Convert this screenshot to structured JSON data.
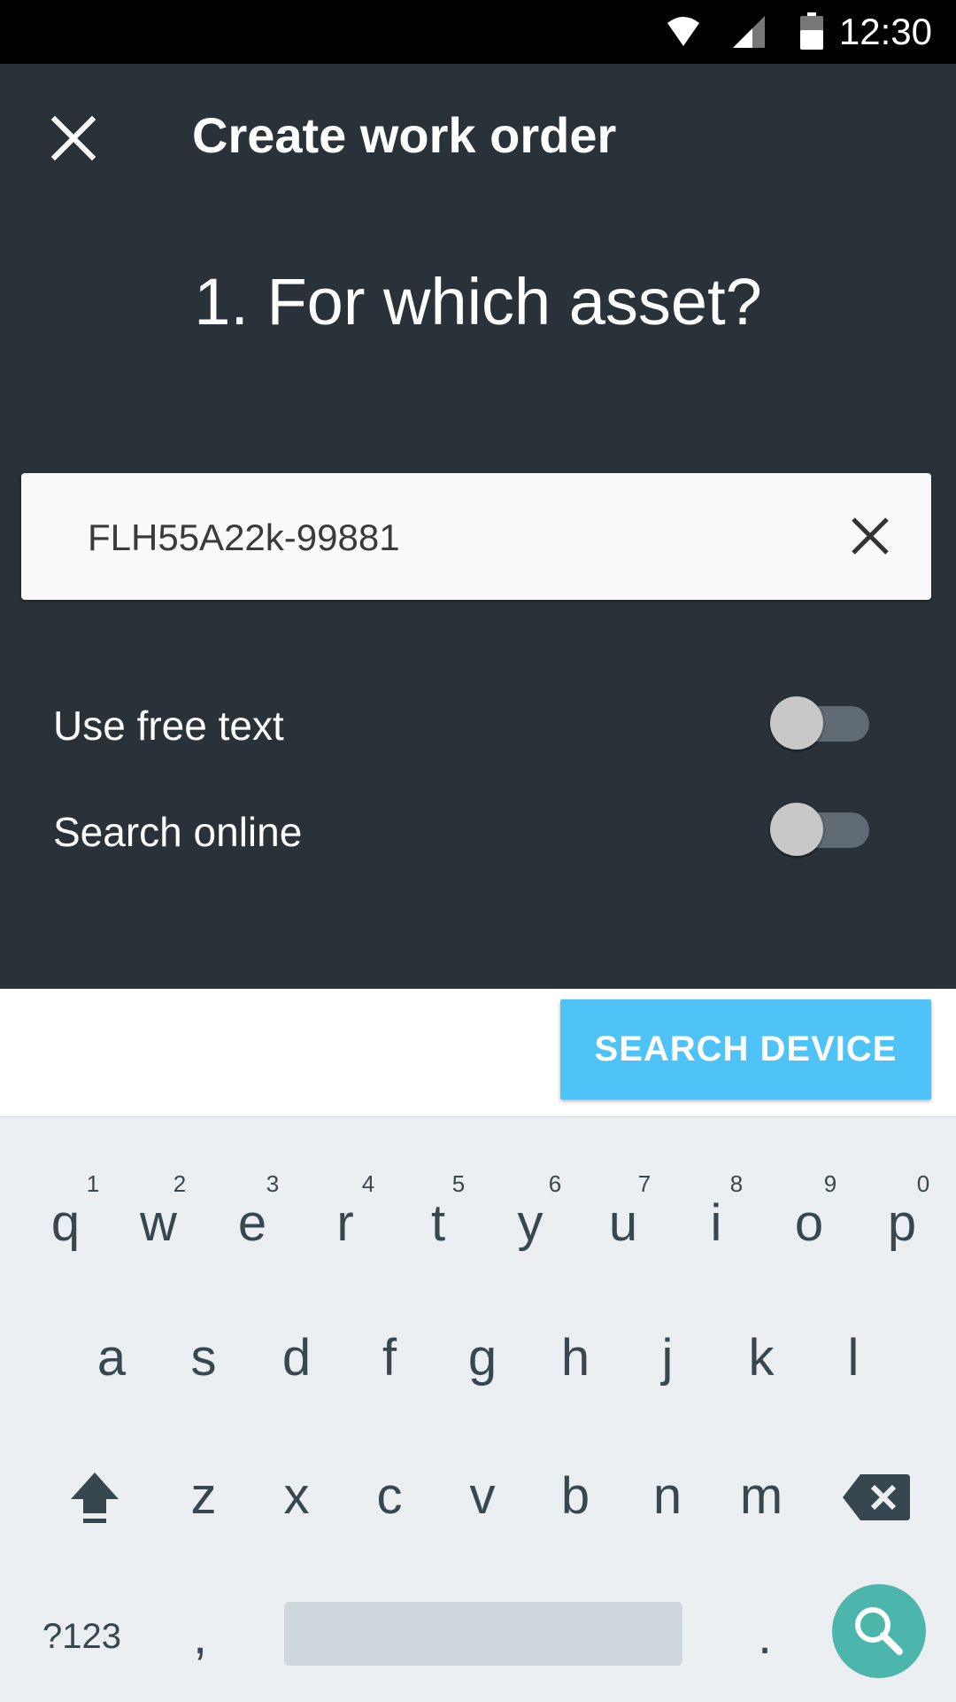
{
  "status_bar": {
    "time": "12:30",
    "icons": [
      "wifi-icon",
      "cell-signal-icon",
      "battery-icon"
    ]
  },
  "header": {
    "close_icon": "close-icon",
    "title": "Create work order"
  },
  "step": {
    "title": "1. For which asset?"
  },
  "asset_input": {
    "value": "FLH55A22k-99881",
    "clear_icon": "clear-icon"
  },
  "options": [
    {
      "label": "Use free text",
      "enabled": false
    },
    {
      "label": "Search online",
      "enabled": false
    }
  ],
  "actions": {
    "search_device_label": "SEARCH DEVICE"
  },
  "keyboard": {
    "row1": [
      "q",
      "w",
      "e",
      "r",
      "t",
      "y",
      "u",
      "i",
      "o",
      "p"
    ],
    "row1_hints": [
      "1",
      "2",
      "3",
      "4",
      "5",
      "6",
      "7",
      "8",
      "9",
      "0"
    ],
    "row2": [
      "a",
      "s",
      "d",
      "f",
      "g",
      "h",
      "j",
      "k",
      "l"
    ],
    "row3": [
      "z",
      "x",
      "c",
      "v",
      "b",
      "n",
      "m"
    ],
    "symbols_label": "?123",
    "comma": ",",
    "period": ".",
    "icons": [
      "shift-icon",
      "backspace-icon",
      "search-icon"
    ]
  },
  "colors": {
    "header_bg": "#283238",
    "accent_button": "#4fc3f7",
    "fab": "#4db6ac",
    "keyboard_bg": "#eceff1"
  }
}
